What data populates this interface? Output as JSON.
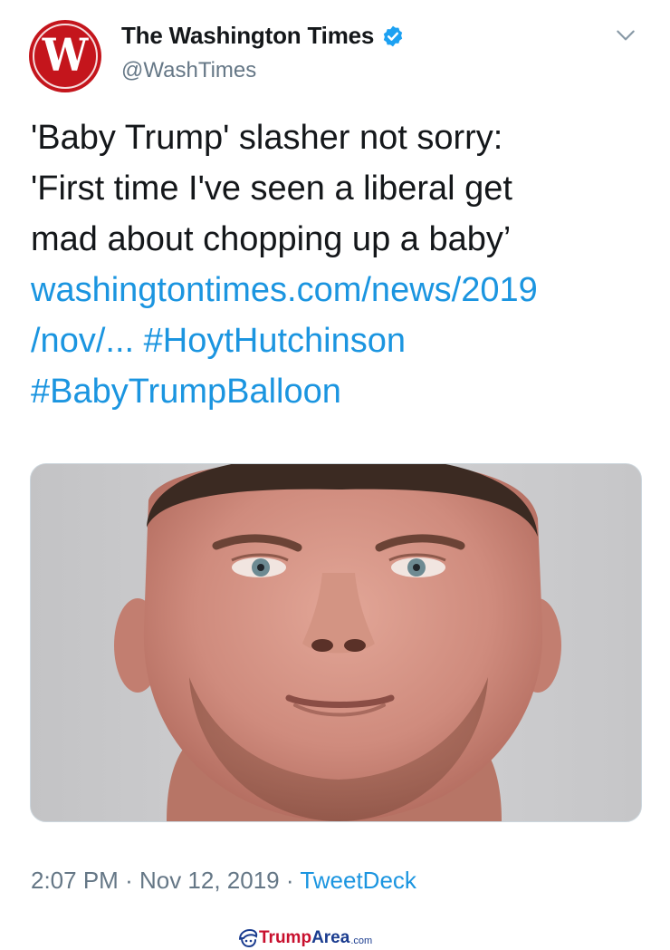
{
  "account": {
    "display_name": "The Washington Times",
    "handle": "@WashTimes",
    "avatar_letter": "W",
    "verified": true,
    "brand_color": "#c4151c"
  },
  "tweet": {
    "lines": [
      {
        "text": "'Baby Trump' slasher not sorry:",
        "type": "text"
      },
      {
        "text": "'First time I've seen a liberal get",
        "type": "text"
      },
      {
        "text": "mad about chopping up a baby’",
        "type": "text"
      },
      {
        "text": "washingtontimes.com/news/2019",
        "type": "link"
      },
      {
        "text": "/nov/...",
        "type": "link"
      },
      {
        "text": "#HoytHutchinson",
        "type": "hashtag"
      },
      {
        "text": "#BabyTrumpBalloon",
        "type": "hashtag"
      }
    ],
    "time": "2:07 PM",
    "separator": "·",
    "date": "Nov 12, 2019",
    "source": "TweetDeck"
  },
  "watermark": {
    "part1": "Trump",
    "part2": "Area",
    "suffix": ".com"
  },
  "colors": {
    "link": "#1b95e0",
    "secondary_text": "#657786",
    "primary_text": "#14171a"
  }
}
